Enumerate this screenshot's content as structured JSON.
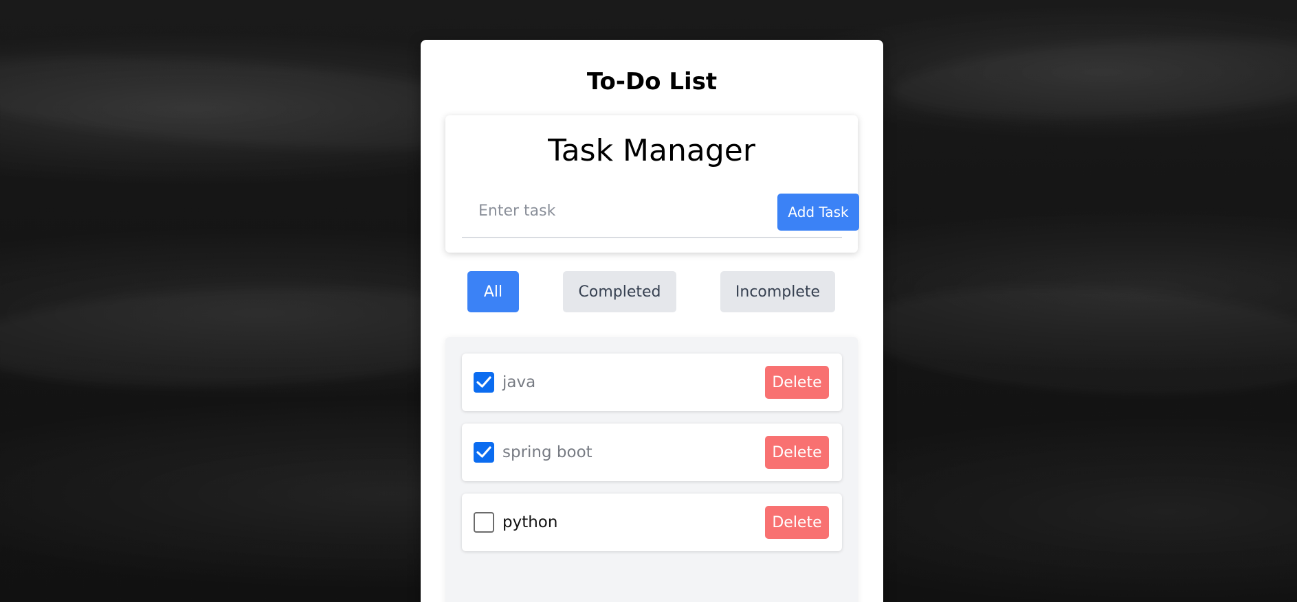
{
  "app": {
    "title": "To-Do List"
  },
  "manager": {
    "heading": "Task Manager",
    "input_placeholder": "Enter task",
    "input_value": "",
    "add_button_label": "Add Task"
  },
  "filters": {
    "active": "All",
    "items": [
      {
        "label": "All",
        "active": true
      },
      {
        "label": "Completed",
        "active": false
      },
      {
        "label": "Incomplete",
        "active": false
      }
    ]
  },
  "tasks": [
    {
      "label": "java",
      "completed": true,
      "delete_label": "Delete"
    },
    {
      "label": "spring boot",
      "completed": true,
      "delete_label": "Delete"
    },
    {
      "label": "python",
      "completed": false,
      "delete_label": "Delete"
    }
  ],
  "colors": {
    "accent": "#3b82f6",
    "danger": "#f87171",
    "checkbox_checked": "#0b6cf0",
    "filter_inactive": "#e5e7eb"
  }
}
